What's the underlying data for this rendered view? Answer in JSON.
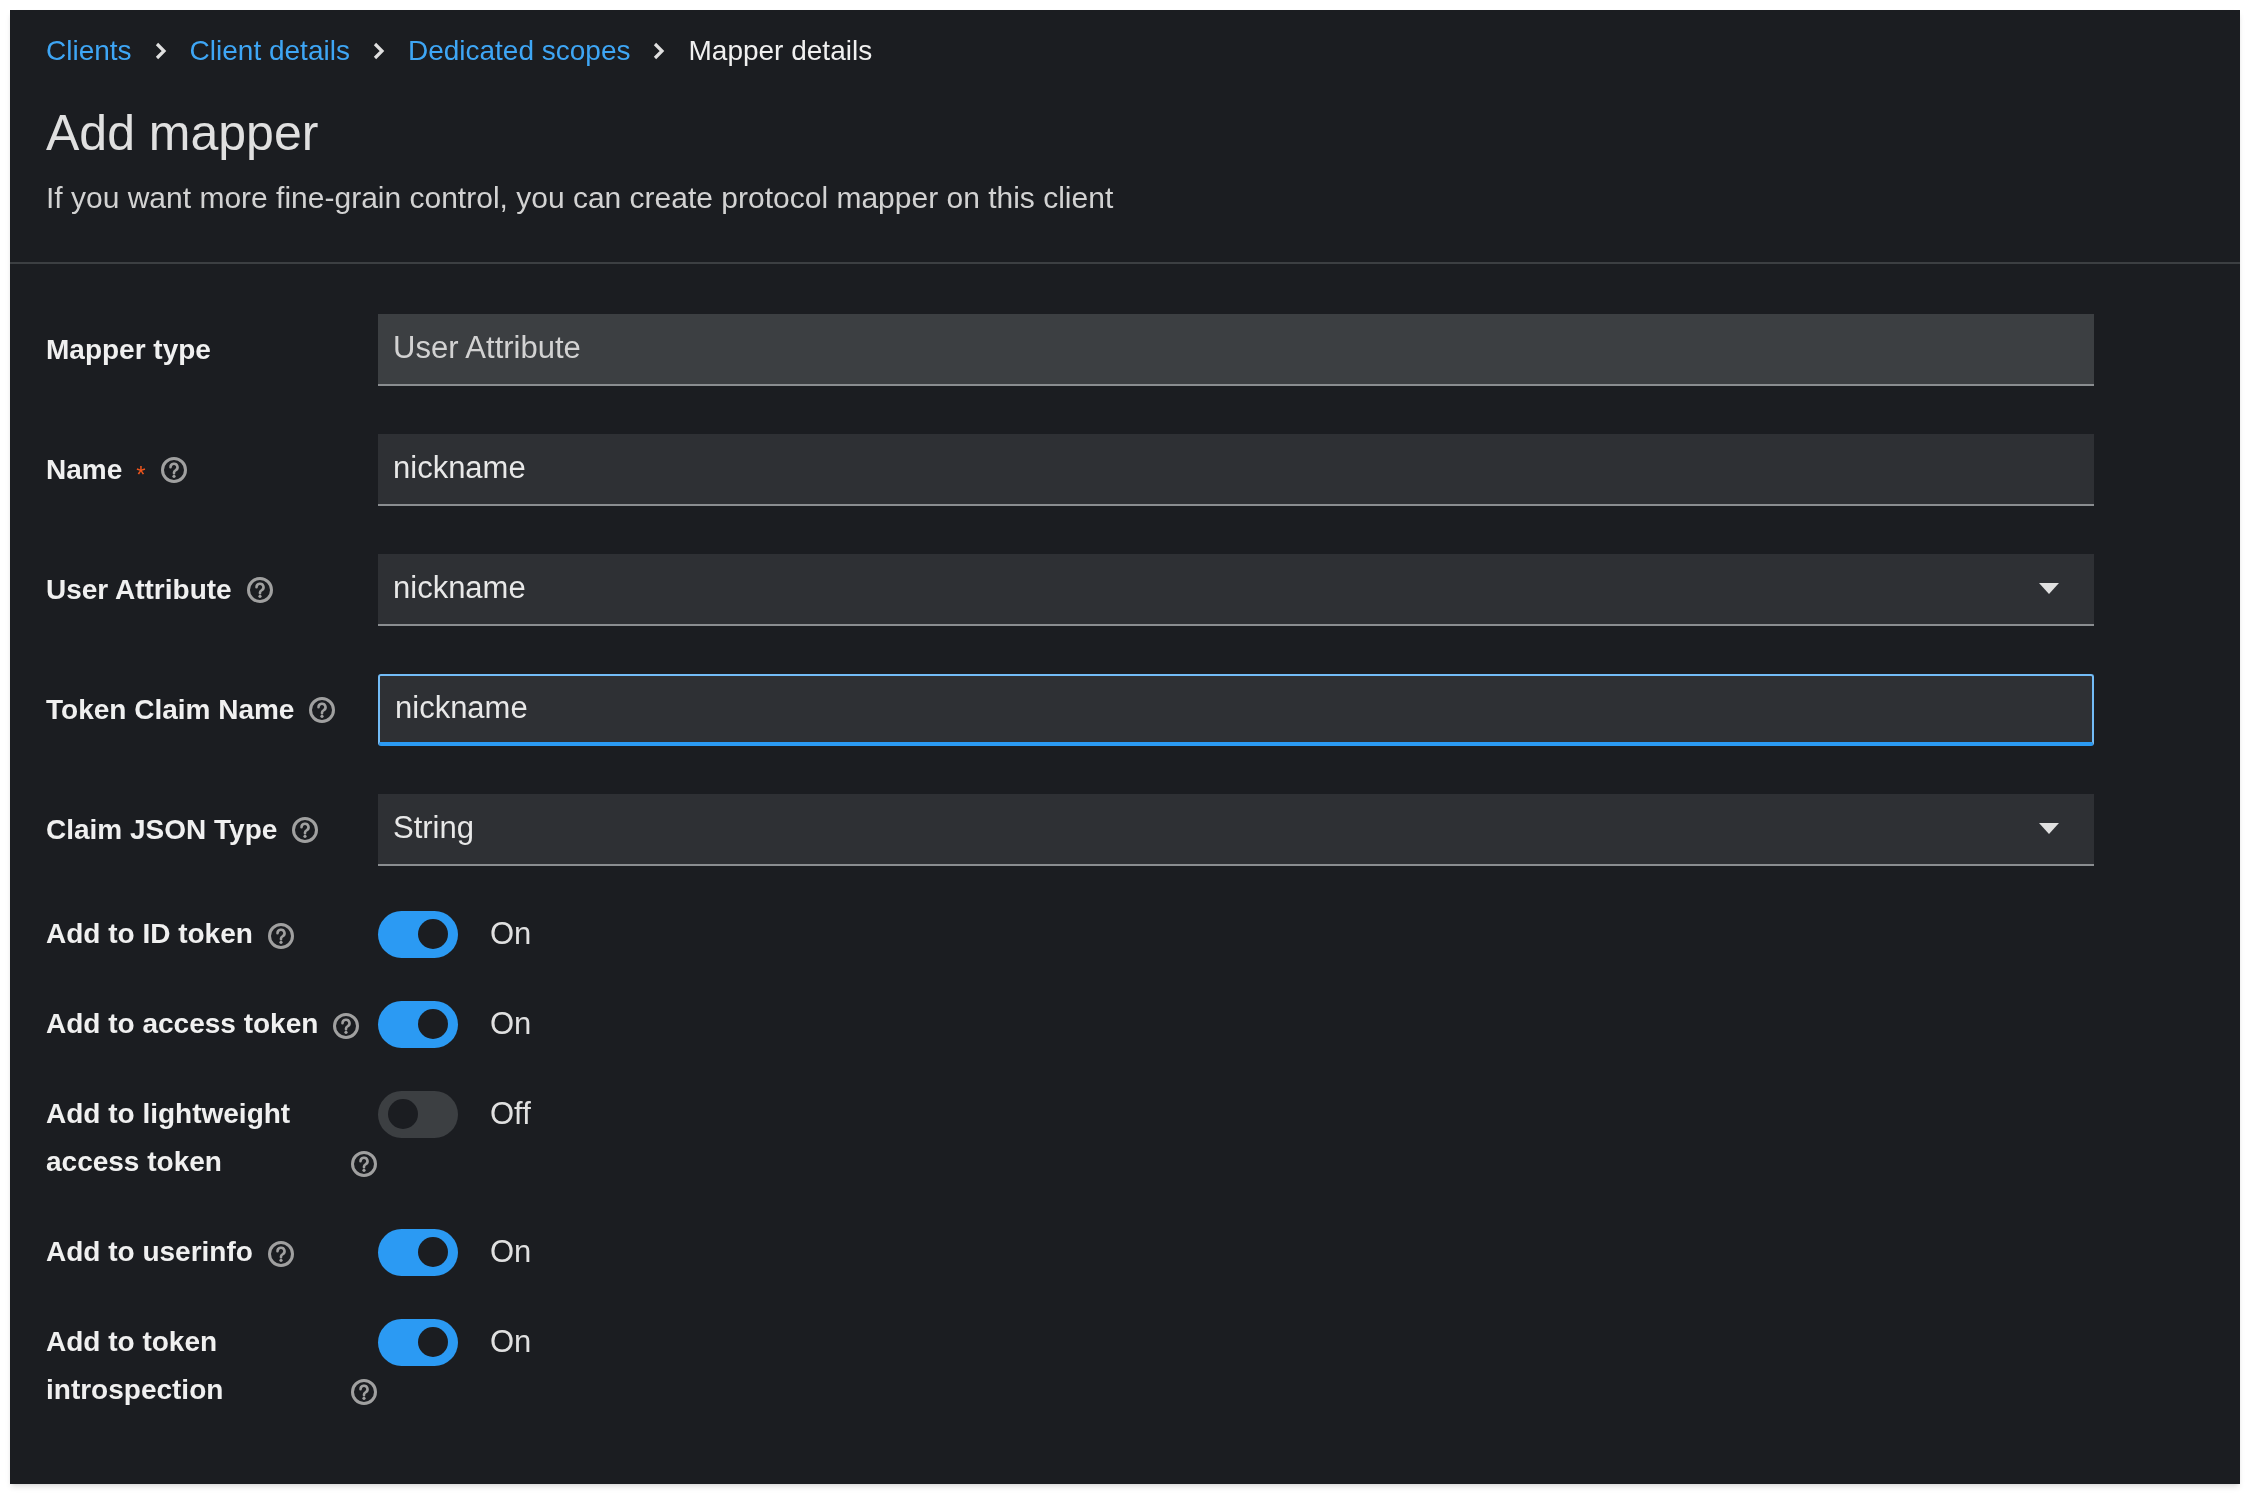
{
  "breadcrumb": [
    {
      "label": "Clients",
      "current": false
    },
    {
      "label": "Client details",
      "current": false
    },
    {
      "label": "Dedicated scopes",
      "current": false
    },
    {
      "label": "Mapper details",
      "current": true
    }
  ],
  "title": "Add mapper",
  "subtitle": "If you want more fine-grain control, you can create protocol mapper on this client",
  "fields": [
    {
      "label": "Mapper type",
      "required": false,
      "help": false,
      "kind": "text",
      "value": "User Attribute",
      "readonly": true,
      "focused": false
    },
    {
      "label": "Name",
      "required": true,
      "required_mark": "*",
      "help": true,
      "kind": "text",
      "value": "nickname",
      "readonly": false,
      "focused": false
    },
    {
      "label": "User Attribute",
      "required": false,
      "help": true,
      "kind": "select",
      "value": "nickname",
      "readonly": false,
      "focused": false
    },
    {
      "label": "Token Claim Name",
      "required": false,
      "help": true,
      "kind": "text",
      "value": "nickname",
      "readonly": false,
      "focused": true
    },
    {
      "label": "Claim JSON Type",
      "required": false,
      "help": true,
      "kind": "select",
      "value": "String",
      "readonly": false,
      "focused": false
    }
  ],
  "toggles": [
    {
      "label": "Add to ID token",
      "on": true,
      "state_label": "On"
    },
    {
      "label": "Add to access token",
      "on": true,
      "state_label": "On"
    },
    {
      "label": "Add to lightweight access token",
      "on": false,
      "state_label": "Off"
    },
    {
      "label": "Add to userinfo",
      "on": true,
      "state_label": "On"
    },
    {
      "label": "Add to token introspection",
      "on": true,
      "state_label": "On"
    }
  ]
}
